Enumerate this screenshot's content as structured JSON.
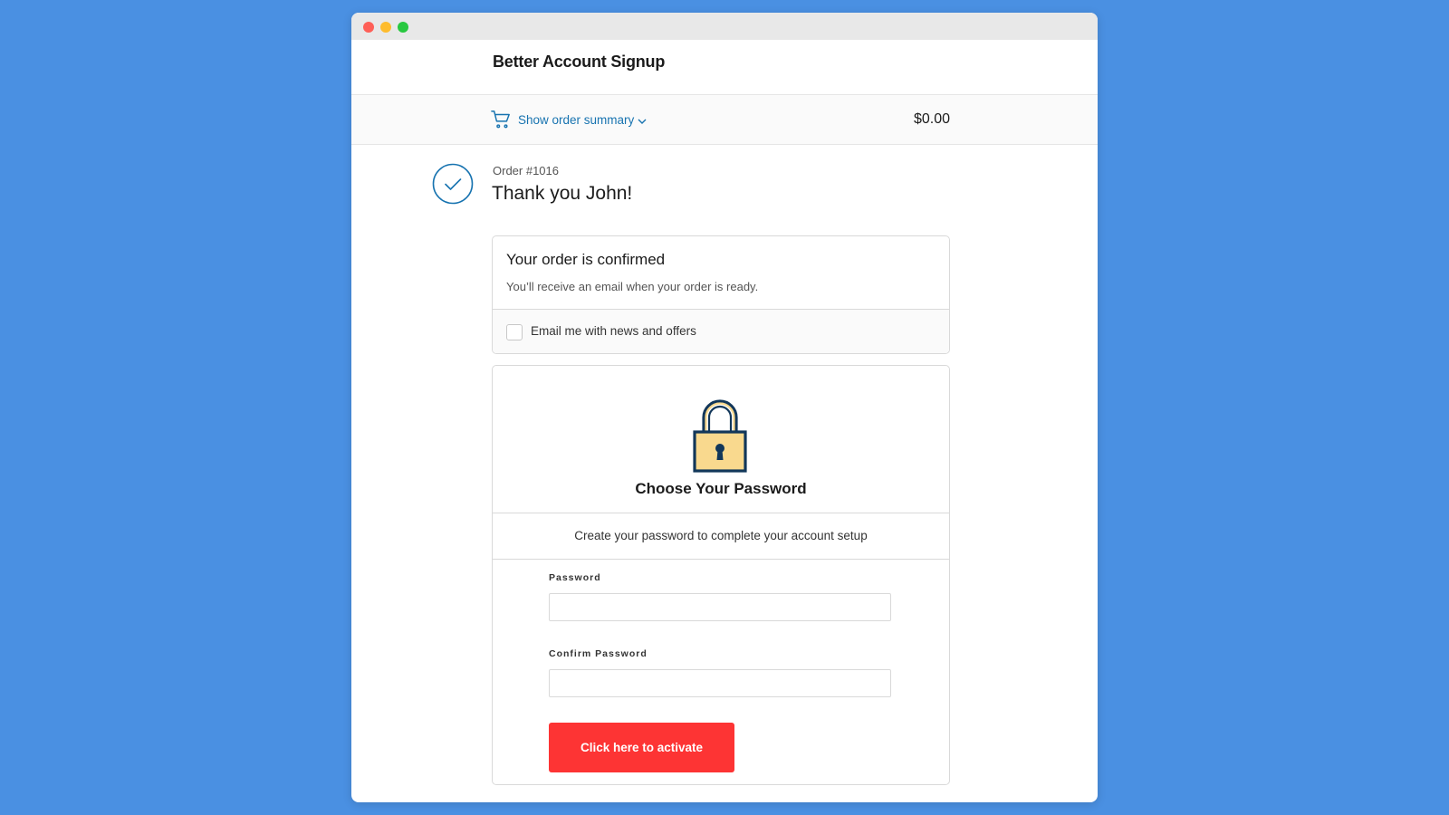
{
  "window": {
    "controls": [
      "close",
      "minimize",
      "maximize"
    ]
  },
  "header": {
    "title": "Better Account Signup"
  },
  "summary": {
    "toggle_label": "Show order summary",
    "total": "$0.00",
    "cart_icon": "cart-icon",
    "chevron_icon": "chevron-down-icon"
  },
  "order": {
    "number": "Order #1016",
    "thank_you": "Thank you John!",
    "status_icon": "check-circle-icon"
  },
  "confirmation": {
    "title": "Your order is confirmed",
    "description": "You’ll receive an email when your order is ready.",
    "newsletter_label": "Email me with news and offers",
    "newsletter_checked": false
  },
  "password_setup": {
    "icon": "lock-icon",
    "title": "Choose Your Password",
    "subtitle": "Create your password to complete your account setup",
    "password_label": "Password",
    "password_value": "",
    "confirm_label": "Confirm Password",
    "confirm_value": "",
    "button_label": "Click here to activate"
  },
  "colors": {
    "background": "#4a90e2",
    "link": "#1773b0",
    "button": "#fd3434",
    "lock_body": "#f9d98e",
    "lock_outline": "#12375a"
  }
}
